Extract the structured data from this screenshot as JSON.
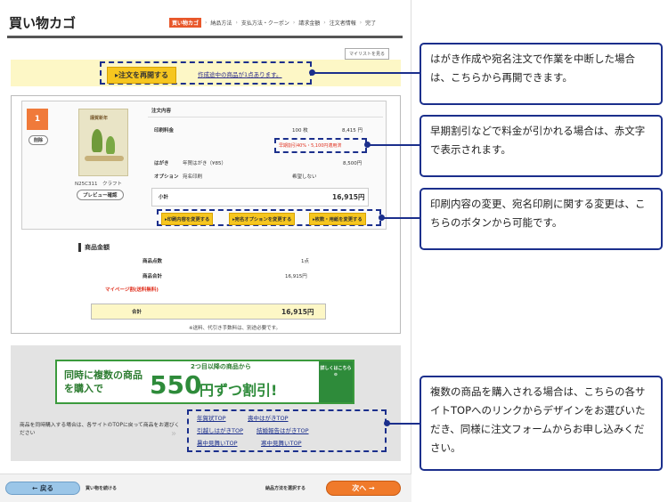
{
  "page": {
    "title": "買い物カゴ",
    "steps": [
      "買い物カゴ",
      "納品方法",
      "支払方法・クーポン",
      "請求金額",
      "注文者情報",
      "完了"
    ],
    "mylist_button": "マイリストを見る"
  },
  "resume": {
    "button": "注文を再開する",
    "link": "作成途中の商品が1点あります。"
  },
  "item": {
    "number": "1",
    "delete_button": "削除",
    "card_title": "謹賀新年",
    "code": "N25C311　クラフト",
    "preview_button": "プレビュー確認",
    "content_heading": "注文内容",
    "print_fee_label": "印刷料金",
    "print_qty": "100 枚",
    "print_price": "8,415 円",
    "discount_note": "早期割引40%・5,100円適用済",
    "postcard_label": "はがき",
    "postcard_desc": "年賀はがき（¥85）",
    "postcard_price": "8,500円",
    "option_label": "オプション",
    "option_desc": "宛名印刷",
    "option_value": "希望しない",
    "subtotal_label": "小計",
    "subtotal_value": "16,915円",
    "change_buttons": [
      "印刷内容を変更する",
      "宛名オプションを変更する",
      "枚数・用紙を変更する"
    ]
  },
  "summary": {
    "heading": "商品金額",
    "rows": [
      {
        "label": "商品点数",
        "value": "1点"
      },
      {
        "label": "商品合計",
        "value": "16,915円"
      }
    ],
    "mypage_discount": "マイページ割(送料無料)",
    "total_label": "合計",
    "total_value": "16,915円",
    "note": "※送料、代引き手数料は、別途必要です。"
  },
  "promo": {
    "banner_left": "同時に複数の商品を購入で",
    "banner_top": "2つ目以降の商品から",
    "banner_amount": "550",
    "banner_suffix": "円ずつ割引!",
    "banner_side": "詳しくはこちら",
    "text": "商品を同時購入する場合は、各サイトのTOPに戻って商品をお選びください",
    "links": [
      [
        "年賀状TOP",
        "喪中はがきTOP"
      ],
      [
        "引越しはがきTOP",
        "結婚報告はがきTOP"
      ],
      [
        "暑中見舞いTOP",
        "寒中見舞いTOP"
      ]
    ]
  },
  "footer": {
    "back_button": "戻る",
    "back_label": "買い物を続ける",
    "next_label": "納品方法を選択する",
    "next_button": "次へ"
  },
  "callouts": [
    "はがき作成や宛名注文で作業を中断した場合は、こちらから再開できます。",
    "早期割引などで料金が引かれる場合は、赤文字で表示されます。",
    "印刷内容の変更、宛名印刷に関する変更は、こちらのボタンから可能です。",
    "複数の商品を購入される場合は、こちらの各サイトTOPへのリンクからデザインをお選びいただき、同様に注文フォームからお申し込みください。"
  ],
  "colors": {
    "accent": "#e8572a",
    "callout_border": "#1b2f8c",
    "button_yellow": "#f6c61f",
    "discount_red": "#e0301e"
  }
}
